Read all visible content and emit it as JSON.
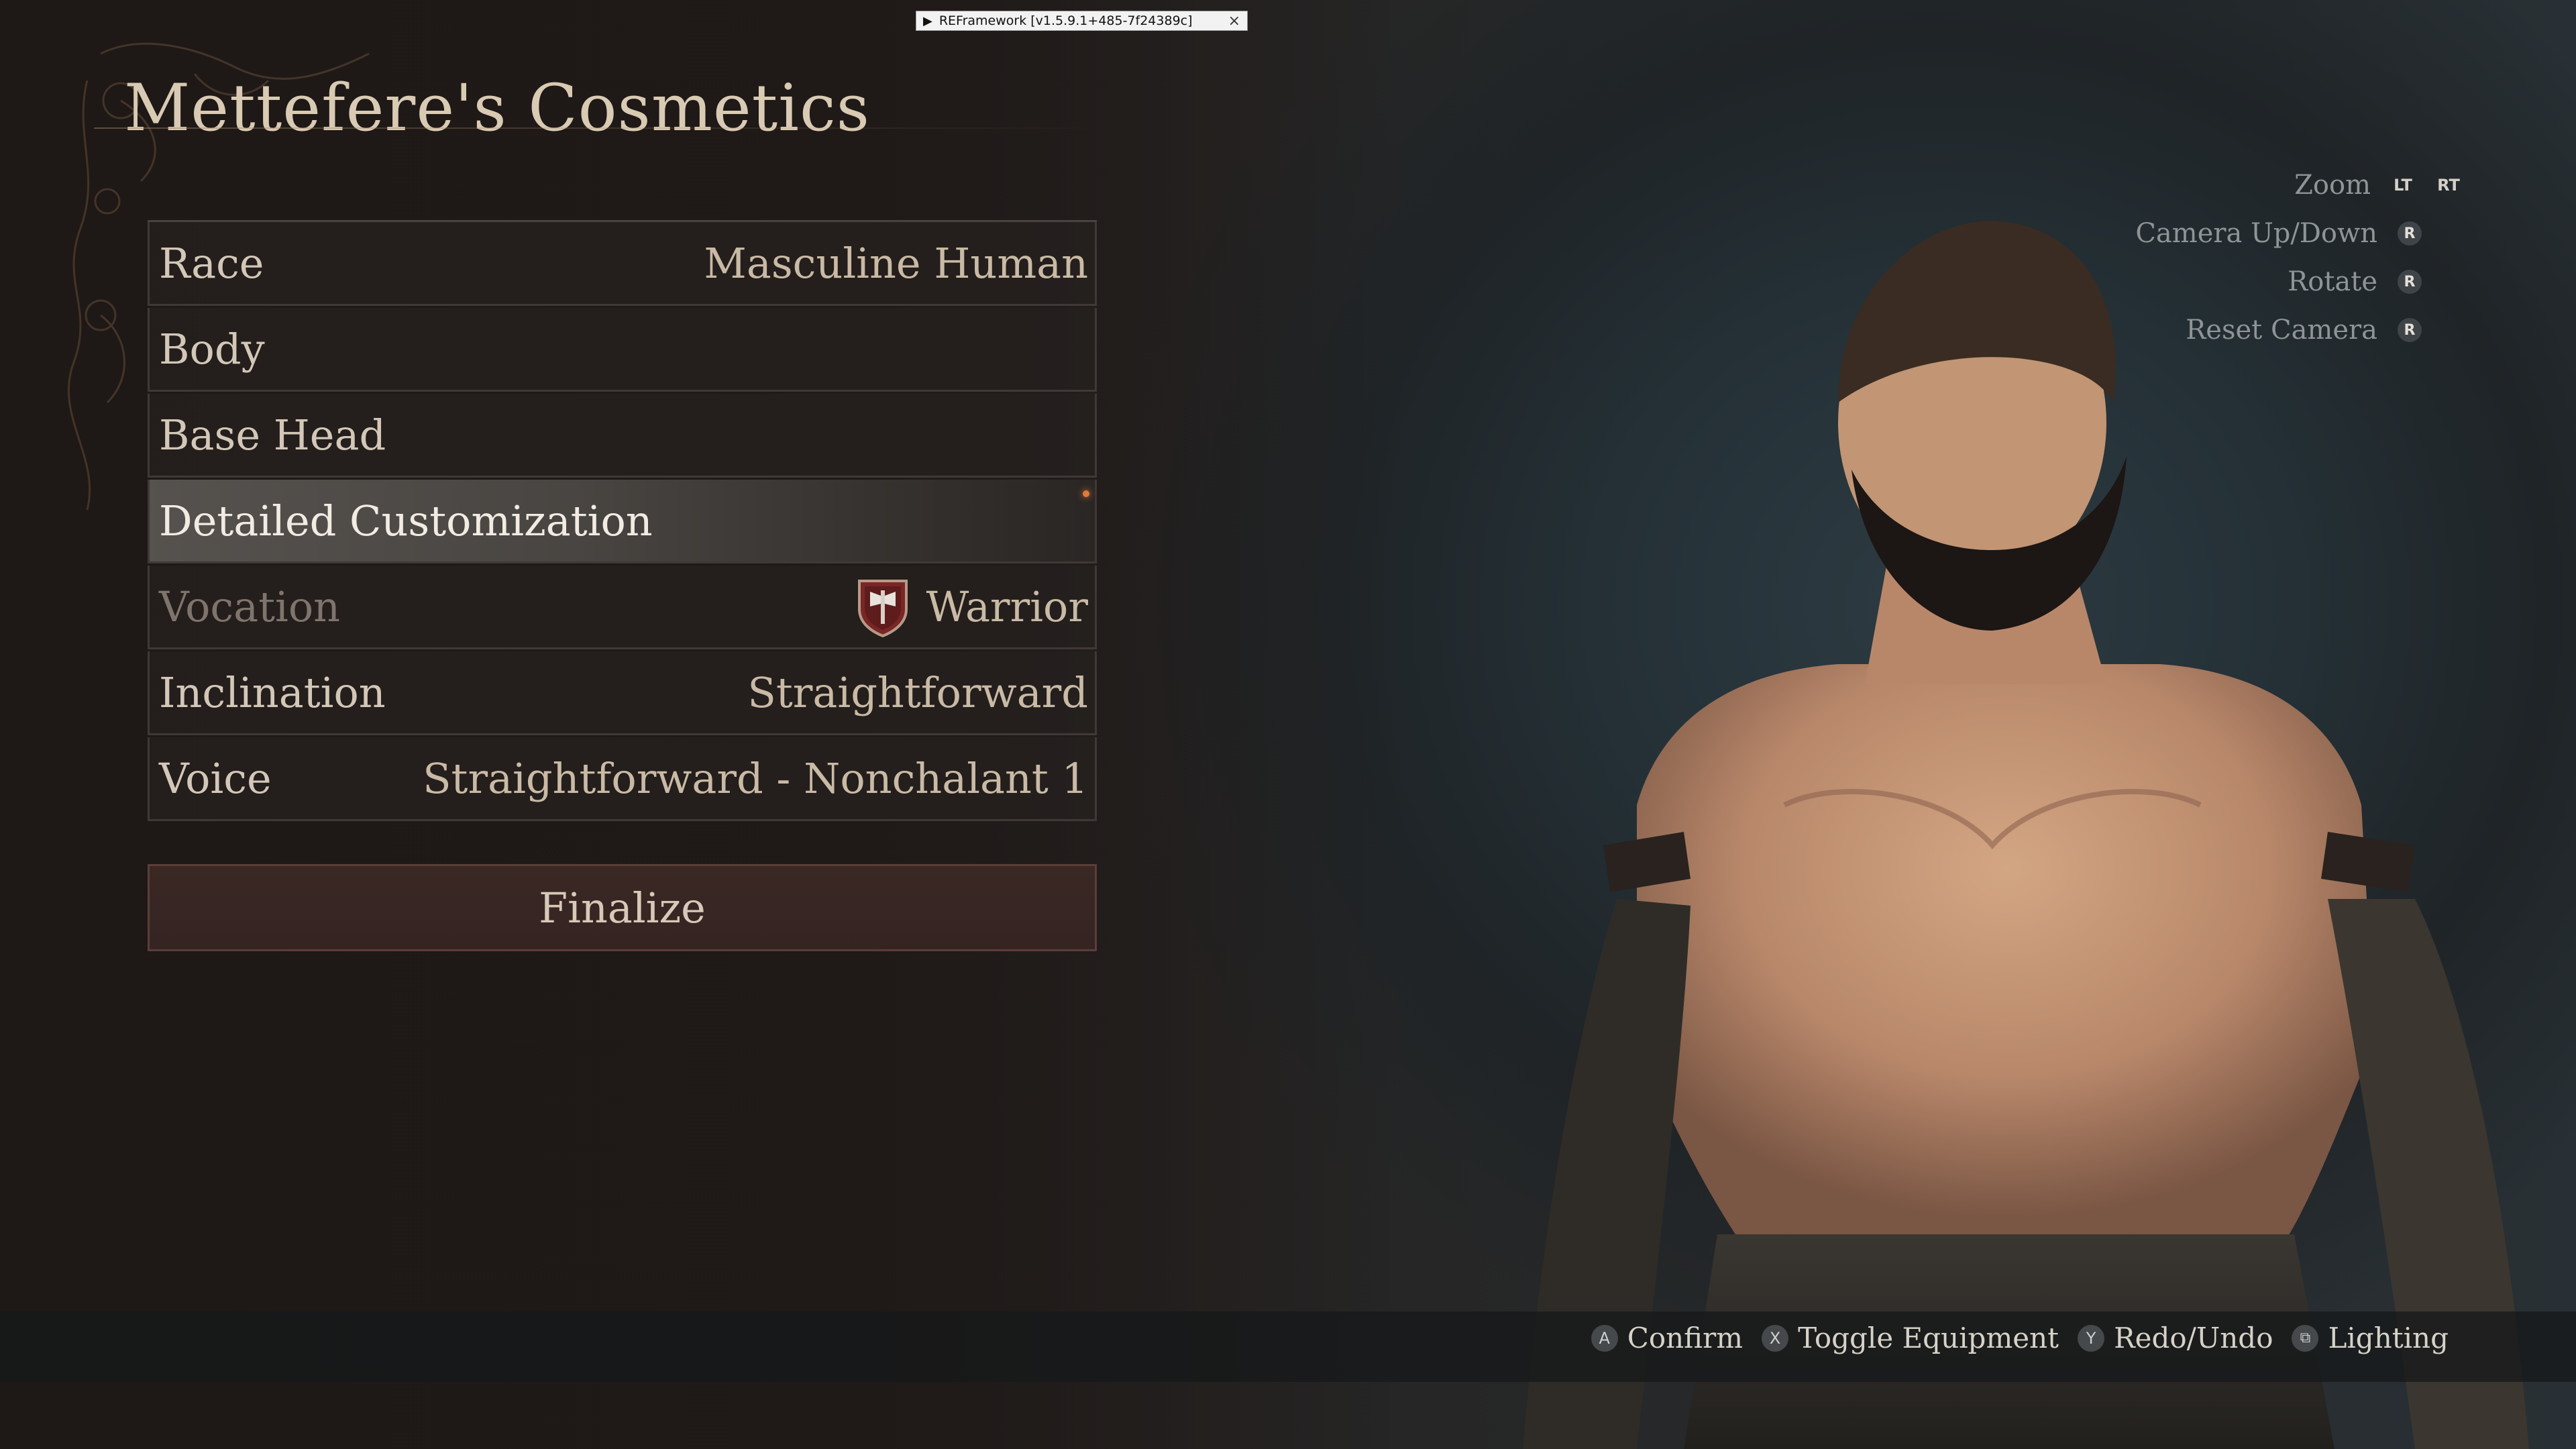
{
  "reframework": {
    "label": "REFramework [v1.5.9.1+485-7f24389c]",
    "close_glyph": "×"
  },
  "title": "Mettefere's Cosmetics",
  "menu": [
    {
      "label": "Race",
      "value": "Masculine Human"
    },
    {
      "label": "Body",
      "value": ""
    },
    {
      "label": "Base Head",
      "value": ""
    },
    {
      "label": "Detailed Customization",
      "value": ""
    },
    {
      "label": "Vocation",
      "value": "Warrior",
      "icon": "warrior-emblem-icon"
    },
    {
      "label": "Inclination",
      "value": "Straightforward"
    },
    {
      "label": "Voice",
      "value": "Straightforward - Nonchalant 1"
    }
  ],
  "finalize_label": "Finalize",
  "camera_controls": [
    {
      "label": "Zoom",
      "buttons": [
        "LT",
        "RT"
      ]
    },
    {
      "label": "Camera Up/Down",
      "buttons": [
        "R"
      ]
    },
    {
      "label": "Rotate",
      "buttons": [
        "R"
      ]
    },
    {
      "label": "Reset Camera",
      "buttons": [
        "R"
      ]
    }
  ],
  "hints": [
    {
      "button": "A",
      "label": "Confirm"
    },
    {
      "button": "X",
      "label": "Toggle Equipment"
    },
    {
      "button": "Y",
      "label": "Redo/Undo"
    },
    {
      "button": "⧉",
      "label": "Lighting"
    }
  ],
  "colors": {
    "selected_row": "#5f5c58",
    "finalize_bg": "#3b2825",
    "accent_spark": "#e07a3a"
  }
}
